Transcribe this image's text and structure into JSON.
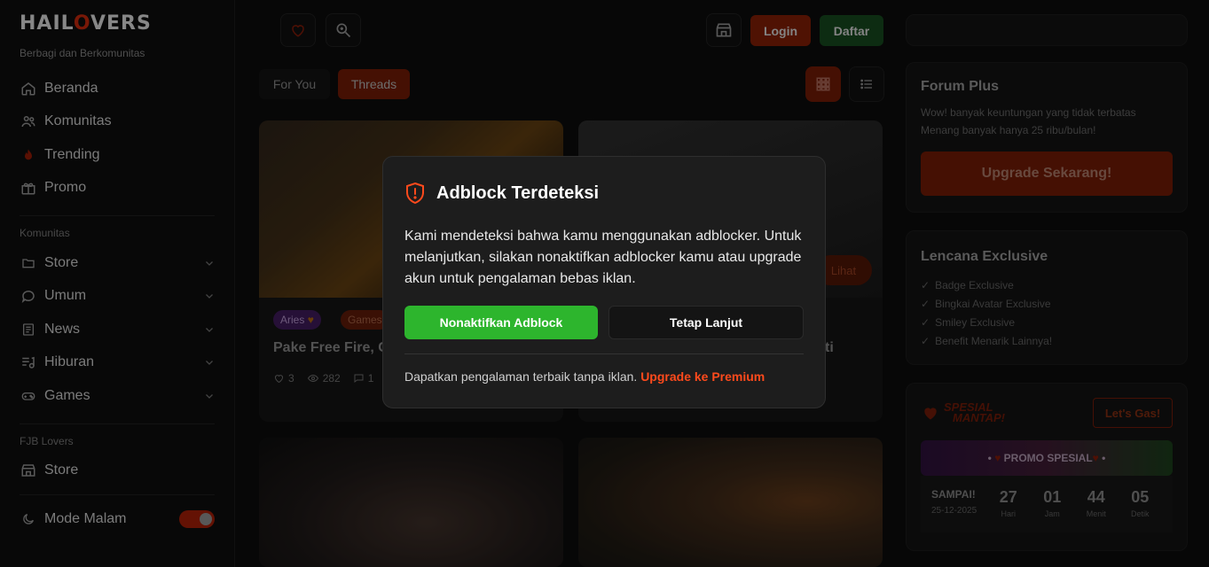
{
  "brand": {
    "logo_pre": "HAIL",
    "logo_o": "O",
    "logo_post": "VERS",
    "tagline": "Berbagi dan Berkomunitas"
  },
  "sidebar": {
    "main_items": [
      {
        "label": "Beranda",
        "icon": "home-icon"
      },
      {
        "label": "Komunitas",
        "icon": "users-icon"
      },
      {
        "label": "Trending",
        "icon": "fire-icon"
      },
      {
        "label": "Promo",
        "icon": "gift-icon"
      }
    ],
    "komunitas_label": "Komunitas",
    "komunitas_items": [
      {
        "label": "Store",
        "icon": "folder-icon"
      },
      {
        "label": "Umum",
        "icon": "chat-icon"
      },
      {
        "label": "News",
        "icon": "newspaper-icon"
      },
      {
        "label": "Hiburan",
        "icon": "music-icon"
      },
      {
        "label": "Games",
        "icon": "gamepad-icon"
      }
    ],
    "fjb_label": "FJB Lovers",
    "fjb_items": [
      {
        "label": "Store",
        "icon": "store-icon"
      }
    ],
    "dark_mode_label": "Mode Malam",
    "dark_mode_on": true
  },
  "header": {
    "login": "Login",
    "register": "Daftar"
  },
  "tabs": {
    "for_you": "For You",
    "threads": "Threads",
    "active": "threads"
  },
  "cards": [
    {
      "tag1": "Aries",
      "tag2": "Games",
      "title": "Pake Free Fire, G",
      "likes": "3",
      "views": "282",
      "comments": "1"
    },
    {
      "title_tail": "ti",
      "lihat": "Lihat"
    }
  ],
  "forum_plus": {
    "title": "Forum Plus",
    "line1": "Wow! banyak keuntungan yang tidak terbatas",
    "line2": "Menang banyak hanya 25 ribu/bulan!",
    "button": "Upgrade Sekarang!"
  },
  "lencana": {
    "title": "Lencana Exclusive",
    "items": [
      "Badge Exclusive",
      "Bingkai Avatar Exclusive",
      "Smiley Exclusive",
      "Benefit Menarik Lainnya!"
    ]
  },
  "promo": {
    "logo_line1": "SPESIAL",
    "logo_line2": "MANTAP!",
    "cta": "Let's Gas!",
    "banner": "PROMO SPESIAL",
    "until_label": "SAMPAI!",
    "until_date": "25-12-2025",
    "countdown": [
      {
        "num": "27",
        "label": "Hari"
      },
      {
        "num": "01",
        "label": "Jam"
      },
      {
        "num": "44",
        "label": "Menit"
      },
      {
        "num": "05",
        "label": "Detik"
      }
    ]
  },
  "modal": {
    "title": "Adblock Terdeteksi",
    "body": "Kami mendeteksi bahwa kamu menggunakan adblocker. Untuk melanjutkan, silakan nonaktifkan adblocker kamu atau upgrade akun untuk pengalaman bebas iklan.",
    "disable_button": "Nonaktifkan Adblock",
    "continue_button": "Tetap Lanjut",
    "footer_text": "Dapatkan pengalaman terbaik tanpa iklan.",
    "footer_link": "Upgrade ke Premium"
  },
  "colors": {
    "accent": "#ff4a1c",
    "green": "#2db52d",
    "modal_bg": "#1d1d1d"
  }
}
